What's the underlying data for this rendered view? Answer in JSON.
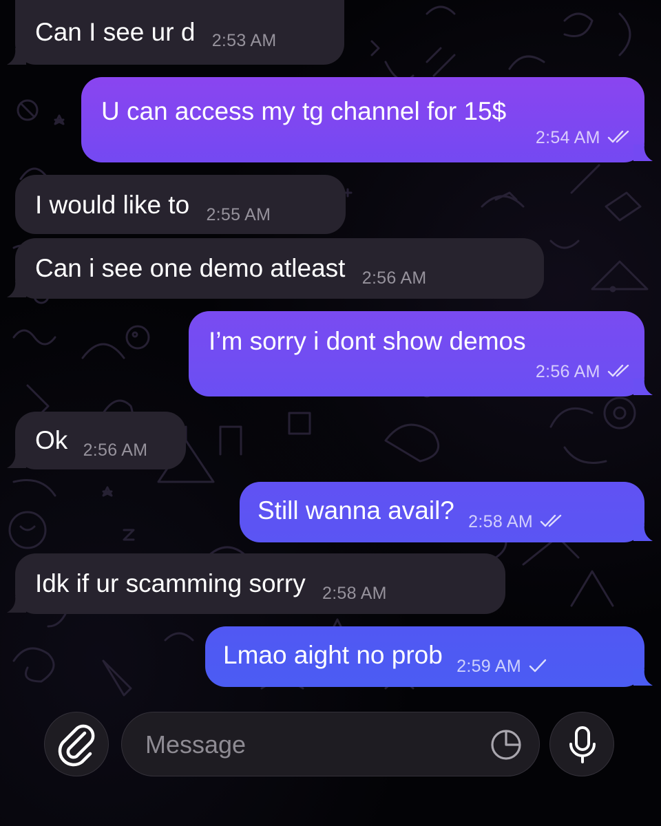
{
  "colors": {
    "incoming_bubble": "#27232e",
    "outgoing_gradient_top": "#8a43f0",
    "outgoing_gradient_bottom": "#5158f2",
    "background": "#030306"
  },
  "messages": [
    {
      "direction": "incoming",
      "text": "Can I see ur d",
      "time": "2:53 AM"
    },
    {
      "direction": "outgoing",
      "text": "U can access my tg channel for 15$",
      "time": "2:54 AM",
      "status": "read"
    },
    {
      "direction": "incoming",
      "text": "I would like to",
      "time": "2:55 AM"
    },
    {
      "direction": "incoming",
      "text": "Can i see one demo atleast",
      "time": "2:56 AM"
    },
    {
      "direction": "outgoing",
      "text": "I’m sorry i dont show demos",
      "time": "2:56 AM",
      "status": "read"
    },
    {
      "direction": "incoming",
      "text": "Ok",
      "time": "2:56 AM"
    },
    {
      "direction": "outgoing",
      "text": "Still wanna avail?",
      "time": "2:58 AM",
      "status": "read"
    },
    {
      "direction": "incoming",
      "text": "Idk if ur scamming sorry",
      "time": "2:58 AM"
    },
    {
      "direction": "outgoing",
      "text": "Lmao aight no prob",
      "time": "2:59 AM",
      "status": "delivered"
    }
  ],
  "composer": {
    "placeholder": "Message",
    "attach_icon": "paperclip-icon",
    "sticker_icon": "sticker-icon",
    "mic_icon": "microphone-icon"
  }
}
